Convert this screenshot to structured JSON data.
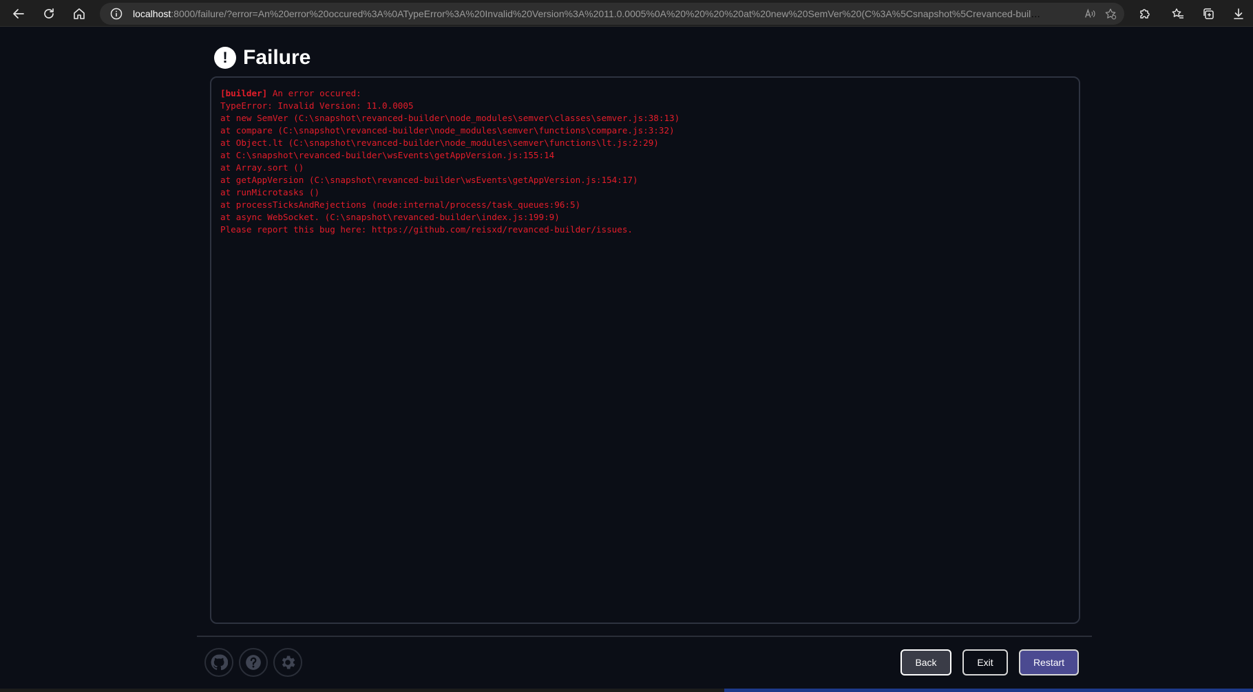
{
  "browser": {
    "url_host": "localhost",
    "url_rest": ":8000/failure/?error=An%20error%20occured%3A%0ATypeError%3A%20Invalid%20Version%3A%2011.0.0005%0A%20%20%20%20at%20new%20SemVer%20(C%3A%5Csnapshot%5Crevanced-builder%5Cnode_..."
  },
  "page": {
    "icon_glyph": "!",
    "title": "Failure"
  },
  "log": {
    "tag": "[builder]",
    "first_line": " An error occured:",
    "lines": [
      "TypeError: Invalid Version: 11.0.0005",
      "at new SemVer (C:\\snapshot\\revanced-builder\\node_modules\\semver\\classes\\semver.js:38:13)",
      "at compare (C:\\snapshot\\revanced-builder\\node_modules\\semver\\functions\\compare.js:3:32)",
      "at Object.lt (C:\\snapshot\\revanced-builder\\node_modules\\semver\\functions\\lt.js:2:29)",
      "at C:\\snapshot\\revanced-builder\\wsEvents\\getAppVersion.js:155:14",
      "at Array.sort ()",
      "at getAppVersion (C:\\snapshot\\revanced-builder\\wsEvents\\getAppVersion.js:154:17)",
      "at runMicrotasks ()",
      "at processTicksAndRejections (node:internal/process/task_queues:96:5)",
      "at async WebSocket. (C:\\snapshot\\revanced-builder\\index.js:199:9)",
      "Please report this bug here: https://github.com/reisxd/revanced-builder/issues."
    ]
  },
  "footer": {
    "back_label": "Back",
    "exit_label": "Exit",
    "restart_label": "Restart"
  },
  "colors": {
    "error_text": "#e51d2a",
    "background": "#0b0e16",
    "restart_bg": "#4b4a91"
  }
}
